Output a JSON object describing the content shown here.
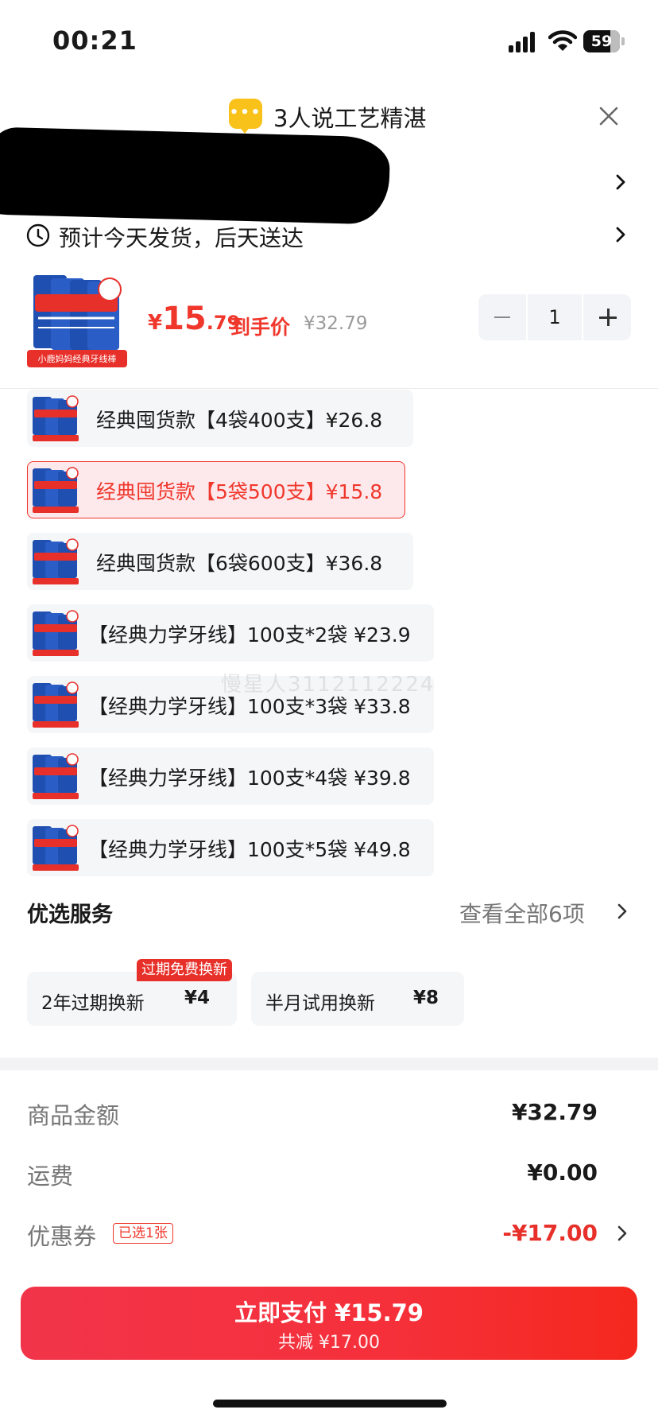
{
  "status_bar": {
    "time": "00:21",
    "battery": "59"
  },
  "header": {
    "title": "3人说工艺精湛"
  },
  "delivery": {
    "text": "预计今天发货，后天送达"
  },
  "product": {
    "price_symbol": "¥",
    "price_int": "15",
    "price_dec": ".79",
    "price_label": "到手价",
    "original_price": "¥32.79",
    "quantity": "1",
    "thumb_caption": "小鹿妈妈经典牙线棒"
  },
  "variants": [
    {
      "label": "经典囤货款【4袋400支】¥26.8",
      "selected": false
    },
    {
      "label": "经典囤货款【5袋500支】¥15.8",
      "selected": true
    },
    {
      "label": "经典囤货款【6袋600支】¥36.8",
      "selected": false
    },
    {
      "label": "【经典力学牙线】100支*2袋  ¥23.9",
      "selected": false
    },
    {
      "label": "【经典力学牙线】100支*3袋  ¥33.8",
      "selected": false
    },
    {
      "label": "【经典力学牙线】100支*4袋  ¥39.8",
      "selected": false
    },
    {
      "label": "【经典力学牙线】100支*5袋  ¥49.8",
      "selected": false
    }
  ],
  "watermark": "慢星人3112112224",
  "services": {
    "title": "优选服务",
    "view_all": "查看全部6项",
    "badge": "过期免费换新",
    "items": [
      {
        "name": "2年过期换新",
        "price": "¥4"
      },
      {
        "name": "半月试用换新",
        "price": "¥8"
      }
    ]
  },
  "summary": {
    "goods_label": "商品金额",
    "goods_value": "¥32.79",
    "shipping_label": "运费",
    "shipping_value": "¥0.00",
    "coupon_label": "优惠券",
    "coupon_badge": "已选1张",
    "coupon_value": "-¥17.00"
  },
  "pay": {
    "main": "立即支付 ¥15.79",
    "sub": "共减 ¥17.00"
  },
  "colors": {
    "accent": "#f0372c",
    "badge": "#e8302a",
    "header_icon": "#f8c21a"
  }
}
